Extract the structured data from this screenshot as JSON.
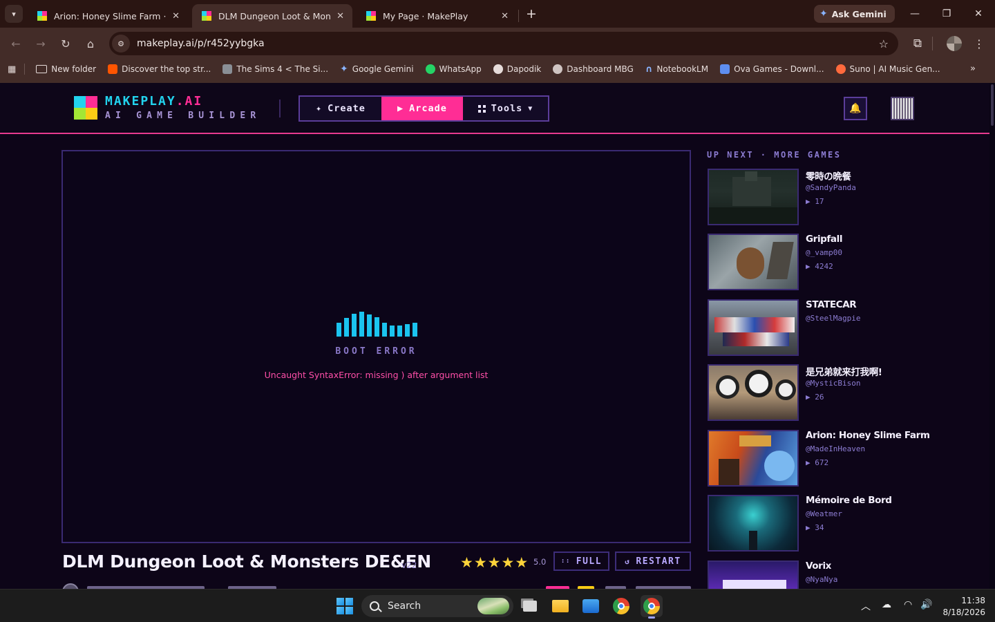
{
  "browser": {
    "tabs": [
      {
        "title": "Arion: Honey Slime Farm · MakePlay",
        "active": false
      },
      {
        "title": "DLM Dungeon Loot & Monsters DE&EN · MakePlay",
        "active": true
      },
      {
        "title": "My Page · MakePlay",
        "active": false
      }
    ],
    "ask_gemini_label": "Ask Gemini",
    "url": "makeplay.ai/p/r452yybgka",
    "bookmarks": [
      {
        "label": "New folder",
        "icon": "folder-icon",
        "color": "#e6dcda"
      },
      {
        "label": "Discover the top str...",
        "icon": "soundcloud-icon",
        "color": "#ff5500"
      },
      {
        "label": "The Sims 4 < The Si...",
        "icon": "sims-icon",
        "color": "#9aa0a6"
      },
      {
        "label": "Google Gemini",
        "icon": "gemini-icon",
        "color": "#8ab4ff"
      },
      {
        "label": "WhatsApp",
        "icon": "whatsapp-icon",
        "color": "#25d366"
      },
      {
        "label": "Dapodik",
        "icon": "dapodik-icon",
        "color": "#e6dcda"
      },
      {
        "label": "Dashboard MBG",
        "icon": "globe-icon",
        "color": "#e6dcda"
      },
      {
        "label": "NotebookLM",
        "icon": "notebooklm-icon",
        "color": "#8ab4ff"
      },
      {
        "label": "Ova Games - Downl...",
        "icon": "ova-icon",
        "color": "#7aa7ff"
      },
      {
        "label": "Suno | AI Music Gen...",
        "icon": "suno-icon",
        "color": "#ff6a3d"
      }
    ]
  },
  "site": {
    "logo_primary": "MAKEPLAY",
    "logo_dot": ".",
    "logo_suffix": "AI",
    "tagline": "AI GAME BUILDER",
    "nav": {
      "create": "Create",
      "arcade": "Arcade",
      "tools": "Tools"
    },
    "accent_pink": "#ff2d95",
    "accent_cyan": "#22d3ee"
  },
  "player": {
    "status": "BOOT ERROR",
    "error_message": "Uncaught SyntaxError: missing ) after argument list"
  },
  "game": {
    "title": "DLM Dungeon Loot & Monsters DE&EN",
    "version": "v22",
    "rating_stars": 5,
    "rating": "5.0",
    "full_label": "FULL",
    "restart_label": "RESTART"
  },
  "up_next": {
    "heading": "UP NEXT · MORE GAMES",
    "cards": [
      {
        "title": "零時の晩餐",
        "author": "@SandyPanda",
        "plays": "17"
      },
      {
        "title": "Gripfall",
        "author": "@_vamp00",
        "plays": "4242"
      },
      {
        "title": "STATECAR",
        "author": "@SteelMagpie",
        "plays": ""
      },
      {
        "title": "是兄弟就来打我啊!",
        "author": "@MysticBison",
        "plays": "26"
      },
      {
        "title": "Arion: Honey Slime Farm",
        "author": "@MadeInHeaven",
        "plays": "672"
      },
      {
        "title": "Mémoire de Bord",
        "author": "@Weatmer",
        "plays": "34"
      },
      {
        "title": "Vorix",
        "author": "@NyaNya",
        "plays": ""
      }
    ]
  },
  "taskbar": {
    "search_label": "Search",
    "time": "11:38",
    "date": "8/18/2026"
  }
}
